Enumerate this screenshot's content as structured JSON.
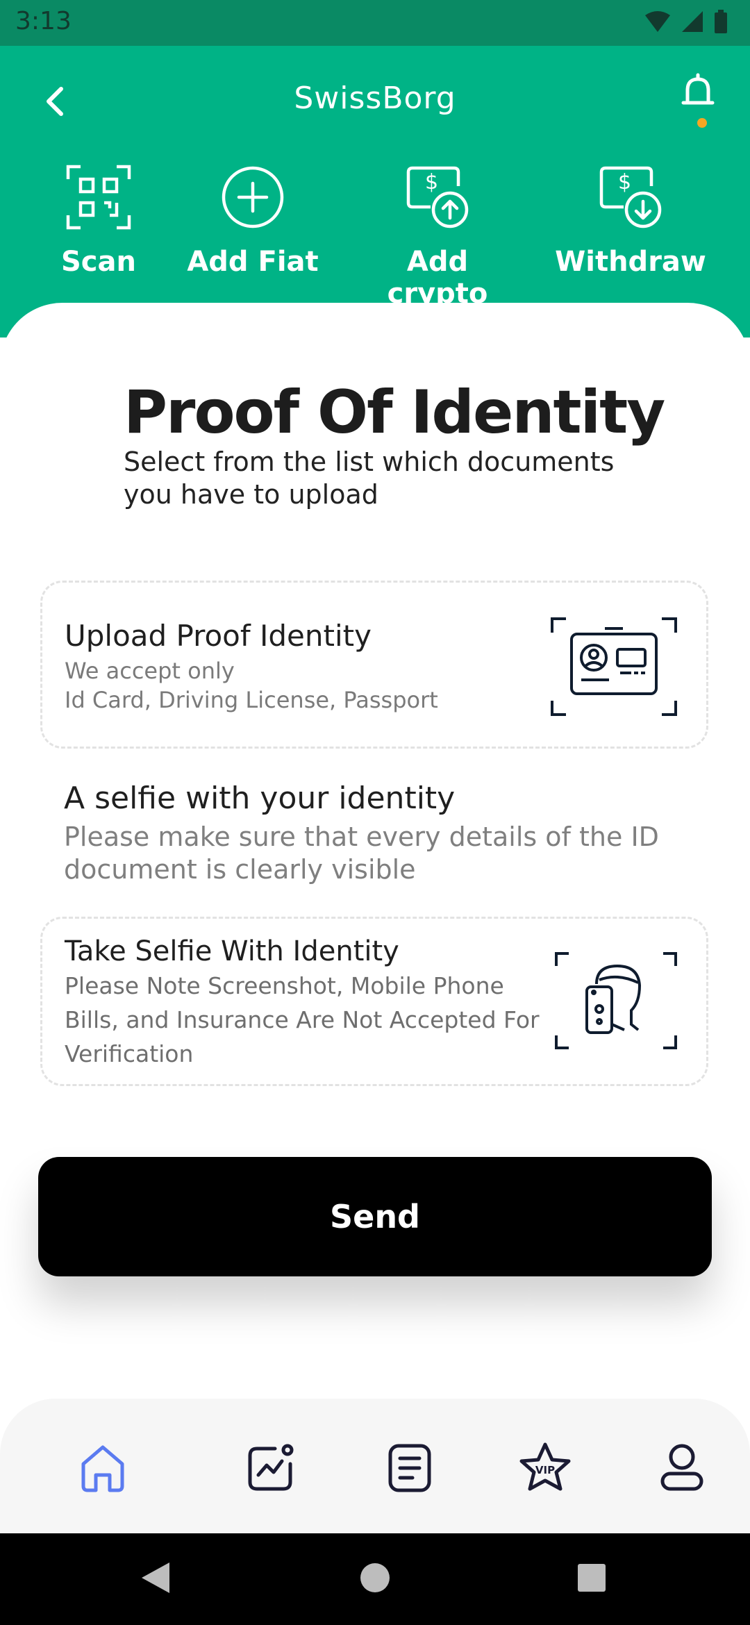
{
  "status_bar": {
    "time": "3:13"
  },
  "header": {
    "title": "SwissBorg",
    "actions": [
      {
        "label": "Scan",
        "icon": "qr-scan-icon"
      },
      {
        "label": "Add Fiat",
        "icon": "plus-circle-icon"
      },
      {
        "label": "Add crypto",
        "icon": "dollar-upload-icon"
      },
      {
        "label": "Withdraw",
        "icon": "dollar-download-icon"
      }
    ],
    "notification_dot_color": "#f5a623",
    "brand_color": "#00b386"
  },
  "main": {
    "title": "Proof Of Identity",
    "subtitle": "Select from the list which documents you have to upload",
    "upload_card": {
      "title": "Upload Proof Identity",
      "line1": "We accept only",
      "line2": "Id Card, Driving License, Passport",
      "icon": "id-card-scan-icon"
    },
    "selfie_section": {
      "title": "A selfie with your identity",
      "text": "Please make sure that every details of the ID document is clearly visible"
    },
    "selfie_card": {
      "title": "Take Selfie With Identity",
      "text": "Please Note Screenshot, Mobile Phone Bills, and Insurance Are Not Accepted For Verification",
      "icon": "selfie-scan-icon"
    },
    "send_label": "Send"
  },
  "bottom_nav": [
    {
      "icon": "home-icon",
      "active": true
    },
    {
      "icon": "chart-icon",
      "active": false
    },
    {
      "icon": "document-icon",
      "active": false
    },
    {
      "icon": "vip-star-icon",
      "active": false
    },
    {
      "icon": "profile-icon",
      "active": false
    }
  ]
}
